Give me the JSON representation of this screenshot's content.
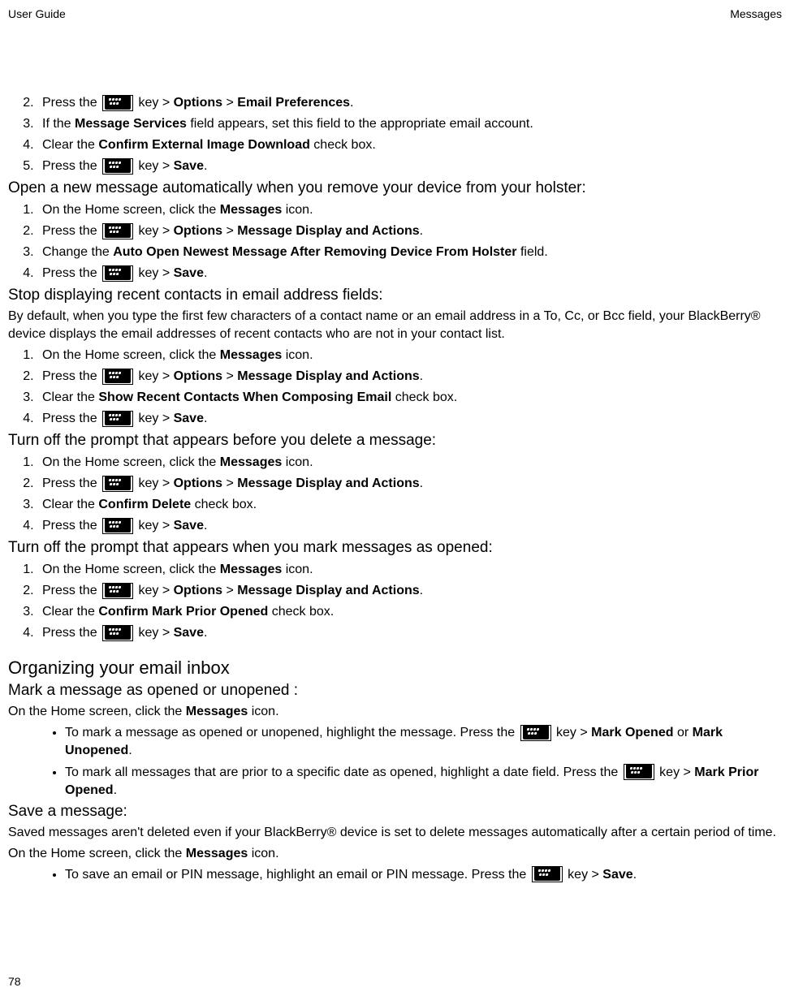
{
  "header": {
    "left": "User Guide",
    "right": "Messages"
  },
  "footer": {
    "pageno": "78"
  },
  "continued_steps": [
    {
      "n": "2.",
      "pre": "Press the ",
      "key": true,
      "post": " key > ",
      "strong1": "Options",
      "mid": " > ",
      "strong2": "Email Preferences",
      "end": "."
    },
    {
      "n": "3.",
      "text_parts": [
        "If the ",
        "Message Services",
        " field appears, set this field to the appropriate email account."
      ]
    },
    {
      "n": "4.",
      "text_parts": [
        "Clear the ",
        "Confirm External Image Download",
        " check box."
      ]
    },
    {
      "n": "5.",
      "pre": "Press the ",
      "key": true,
      "post": " key > ",
      "strong1": "Save",
      "end": "."
    }
  ],
  "sec1": {
    "title": "Open a new message automatically when you remove your device from your holster:",
    "steps": [
      {
        "n": "1.",
        "text_parts": [
          "On the Home screen, click the ",
          "Messages",
          " icon."
        ]
      },
      {
        "n": "2.",
        "pre": "Press the ",
        "key": true,
        "post": " key > ",
        "strong1": "Options",
        "mid": " > ",
        "strong2": "Message Display and Actions",
        "end": "."
      },
      {
        "n": "3.",
        "text_parts": [
          "Change the ",
          "Auto Open Newest Message After Removing Device From Holster",
          " field."
        ]
      },
      {
        "n": "4.",
        "pre": "Press the ",
        "key": true,
        "post": " key > ",
        "strong1": "Save",
        "end": "."
      }
    ]
  },
  "sec2": {
    "title": "Stop displaying recent contacts in email address fields:",
    "intro": "By default, when you type the first few characters of a contact name or an email address in a To, Cc, or Bcc field, your BlackBerry® device displays the email addresses of recent contacts who are not in your contact list.",
    "steps": [
      {
        "n": "1.",
        "text_parts": [
          "On the Home screen, click the ",
          "Messages",
          " icon."
        ]
      },
      {
        "n": "2.",
        "pre": "Press the ",
        "key": true,
        "post": " key > ",
        "strong1": "Options",
        "mid": " > ",
        "strong2": "Message Display and Actions",
        "end": "."
      },
      {
        "n": "3.",
        "text_parts": [
          "Clear the ",
          "Show Recent Contacts When Composing Email",
          " check box."
        ]
      },
      {
        "n": "4.",
        "pre": "Press the ",
        "key": true,
        "post": " key > ",
        "strong1": "Save",
        "end": "."
      }
    ]
  },
  "sec3": {
    "title": "Turn off the prompt that appears before you delete a message:",
    "steps": [
      {
        "n": "1.",
        "text_parts": [
          "On the Home screen, click the ",
          "Messages",
          " icon."
        ]
      },
      {
        "n": "2.",
        "pre": "Press the ",
        "key": true,
        "post": " key > ",
        "strong1": "Options",
        "mid": " > ",
        "strong2": "Message Display and Actions",
        "end": "."
      },
      {
        "n": "3.",
        "text_parts": [
          "Clear the ",
          "Confirm Delete",
          " check box."
        ]
      },
      {
        "n": "4.",
        "pre": "Press the ",
        "key": true,
        "post": " key > ",
        "strong1": "Save",
        "end": "."
      }
    ]
  },
  "sec4": {
    "title": "Turn off the prompt that appears when you mark messages as opened:",
    "steps": [
      {
        "n": "1.",
        "text_parts": [
          "On the Home screen, click the ",
          "Messages",
          " icon."
        ]
      },
      {
        "n": "2.",
        "pre": "Press the ",
        "key": true,
        "post": " key > ",
        "strong1": "Options",
        "mid": " > ",
        "strong2": "Message Display and Actions",
        "end": "."
      },
      {
        "n": "3.",
        "text_parts": [
          "Clear the ",
          "Confirm Mark Prior Opened",
          " check box."
        ]
      },
      {
        "n": "4.",
        "pre": "Press the ",
        "key": true,
        "post": " key > ",
        "strong1": "Save",
        "end": "."
      }
    ]
  },
  "org": {
    "title": "Organizing your email inbox",
    "mark": {
      "title": "Mark a message as opened or unopened :",
      "intro_parts": [
        "On the Home screen, click the ",
        "Messages",
        " icon."
      ],
      "bullets": [
        {
          "pre": "To mark a message as opened or unopened, highlight the message. Press the ",
          "key": true,
          "post": " key > ",
          "strong1": "Mark Opened",
          "mid": " or ",
          "strong2": "Mark Unopened",
          "end": "."
        },
        {
          "pre": "To mark all messages that are prior to a specific date as opened, highlight a date field. Press the ",
          "key": true,
          "post": " key > ",
          "strong1": "Mark Prior Opened",
          "end": "."
        }
      ]
    },
    "save": {
      "title": "Save a message:",
      "para": "Saved messages aren't deleted even if your BlackBerry® device is set to delete messages automatically after a certain period of time.",
      "intro_parts": [
        "On the Home screen, click the ",
        "Messages",
        " icon."
      ],
      "bullets": [
        {
          "pre": "To save an email or PIN message, highlight an email or PIN message. Press the ",
          "key": true,
          "post": " key > ",
          "strong1": "Save",
          "end": "."
        }
      ]
    }
  }
}
